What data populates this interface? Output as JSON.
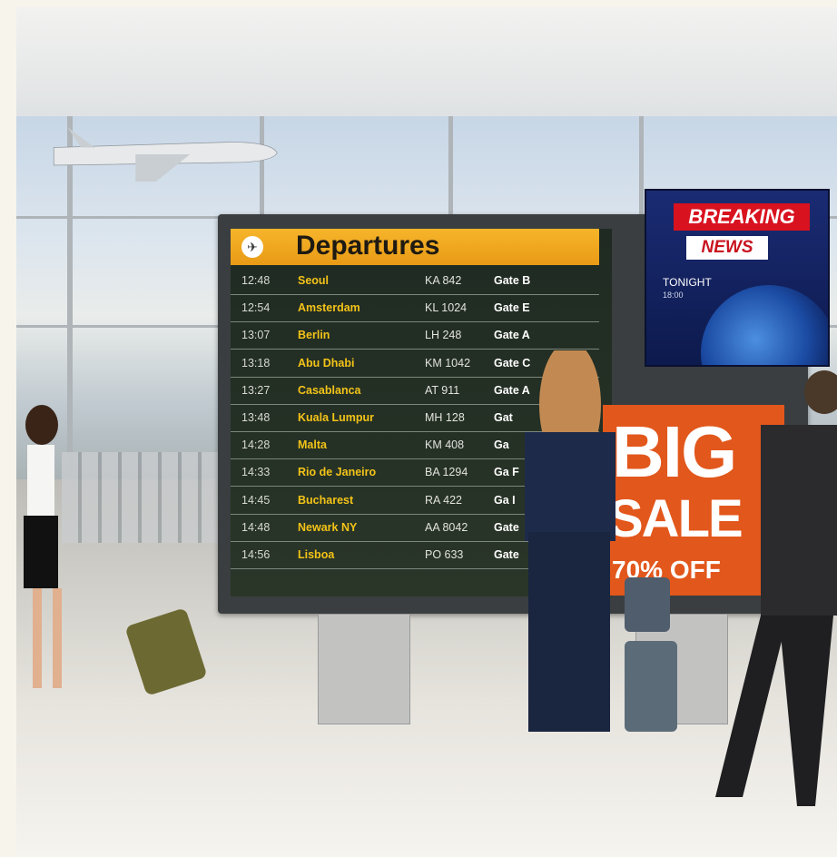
{
  "departures": {
    "title": "Departures",
    "icon": "airplane-icon",
    "rows": [
      {
        "time": "12:48",
        "city": "Seoul",
        "flight": "KA 842",
        "gate": "Gate B"
      },
      {
        "time": "12:54",
        "city": "Amsterdam",
        "flight": "KL 1024",
        "gate": "Gate E"
      },
      {
        "time": "13:07",
        "city": "Berlin",
        "flight": "LH 248",
        "gate": "Gate A"
      },
      {
        "time": "13:18",
        "city": "Abu Dhabi",
        "flight": "KM 1042",
        "gate": "Gate C"
      },
      {
        "time": "13:27",
        "city": "Casablanca",
        "flight": "AT 911",
        "gate": "Gate A"
      },
      {
        "time": "13:48",
        "city": "Kuala Lumpur",
        "flight": "MH 128",
        "gate": "Gat"
      },
      {
        "time": "14:28",
        "city": "Malta",
        "flight": "KM 408",
        "gate": "Ga"
      },
      {
        "time": "14:33",
        "city": "Rio de Janeiro",
        "flight": "BA 1294",
        "gate": "Ga F"
      },
      {
        "time": "14:45",
        "city": "Bucharest",
        "flight": "RA 422",
        "gate": "Ga I"
      },
      {
        "time": "14:48",
        "city": "Newark NY",
        "flight": "AA 8042",
        "gate": "Gate"
      },
      {
        "time": "14:56",
        "city": "Lisboa",
        "flight": "PO 633",
        "gate": "Gate"
      }
    ]
  },
  "news": {
    "breaking": "BREAKING",
    "news": "NEWS",
    "tonight": "TONIGHT",
    "time": "18:00"
  },
  "sale": {
    "big": "BIG",
    "sale": "SALE",
    "off": "70% OFF"
  },
  "colors": {
    "header_yellow": "#f4ad22",
    "city_yellow": "#f3c318",
    "sale_orange": "#e2571c",
    "breaking_red": "#d8121f"
  }
}
